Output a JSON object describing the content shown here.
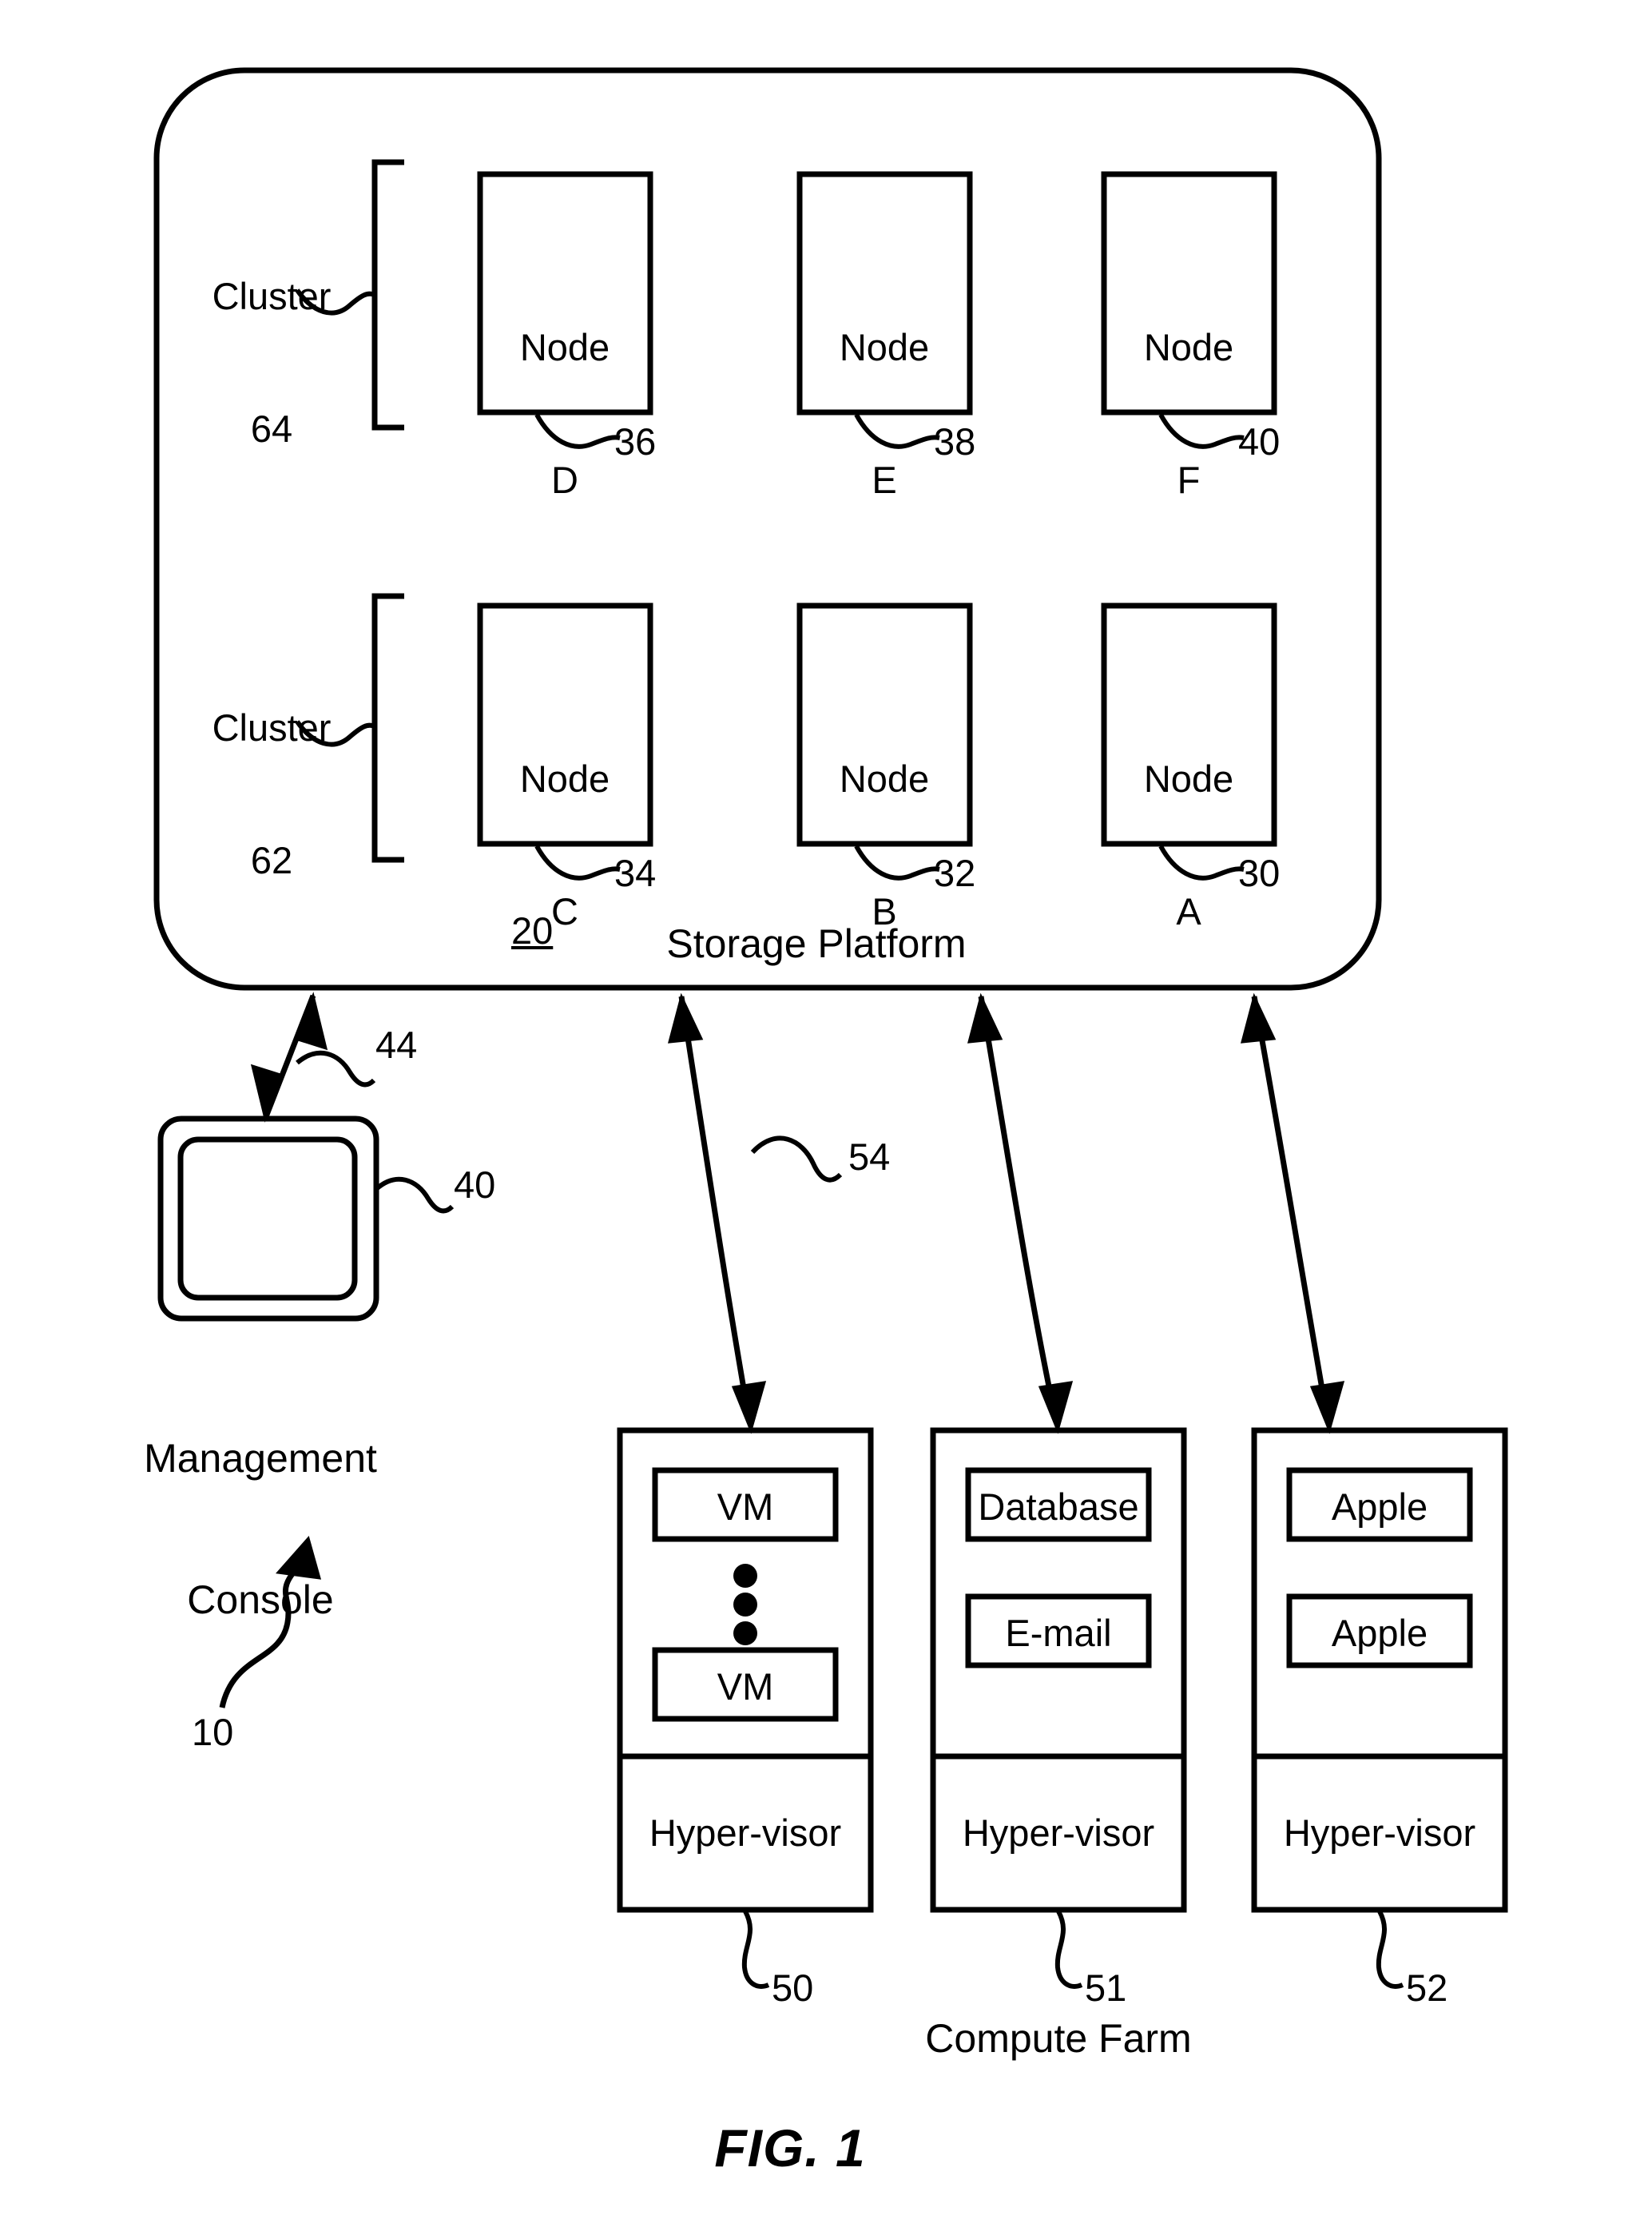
{
  "figure": {
    "caption": "FIG. 1",
    "overall_ref": "10"
  },
  "storage_platform": {
    "title": "Storage Platform",
    "ref": "20",
    "clusters": [
      {
        "label": "Cluster",
        "ref": "64"
      },
      {
        "label": "Cluster",
        "ref": "62"
      }
    ],
    "nodes_top": [
      {
        "line1": "Node",
        "line2": "D",
        "ref": "36"
      },
      {
        "line1": "Node",
        "line2": "E",
        "ref": "38"
      },
      {
        "line1": "Node",
        "line2": "F",
        "ref": "40"
      }
    ],
    "nodes_bottom": [
      {
        "line1": "Node",
        "line2": "C",
        "ref": "34"
      },
      {
        "line1": "Node",
        "line2": "B",
        "ref": "32"
      },
      {
        "line1": "Node",
        "line2": "A",
        "ref": "30"
      }
    ]
  },
  "management_console": {
    "line1": "Management",
    "line2": "Console",
    "ref": "40",
    "link_ref": "44"
  },
  "compute_farm": {
    "title": "Compute Farm",
    "link_ref": "54",
    "servers": [
      {
        "ref": "50",
        "apps": [
          "VM",
          "VM"
        ],
        "has_ellipsis": true,
        "hypervisor": "Hyper-visor"
      },
      {
        "ref": "51",
        "apps": [
          "Database",
          "E-mail"
        ],
        "has_ellipsis": false,
        "hypervisor": "Hyper-visor"
      },
      {
        "ref": "52",
        "apps": [
          "Apple",
          "Apple"
        ],
        "has_ellipsis": false,
        "hypervisor": "Hyper-visor"
      }
    ]
  },
  "colors": {
    "stroke": "#000000",
    "background": "#ffffff"
  }
}
